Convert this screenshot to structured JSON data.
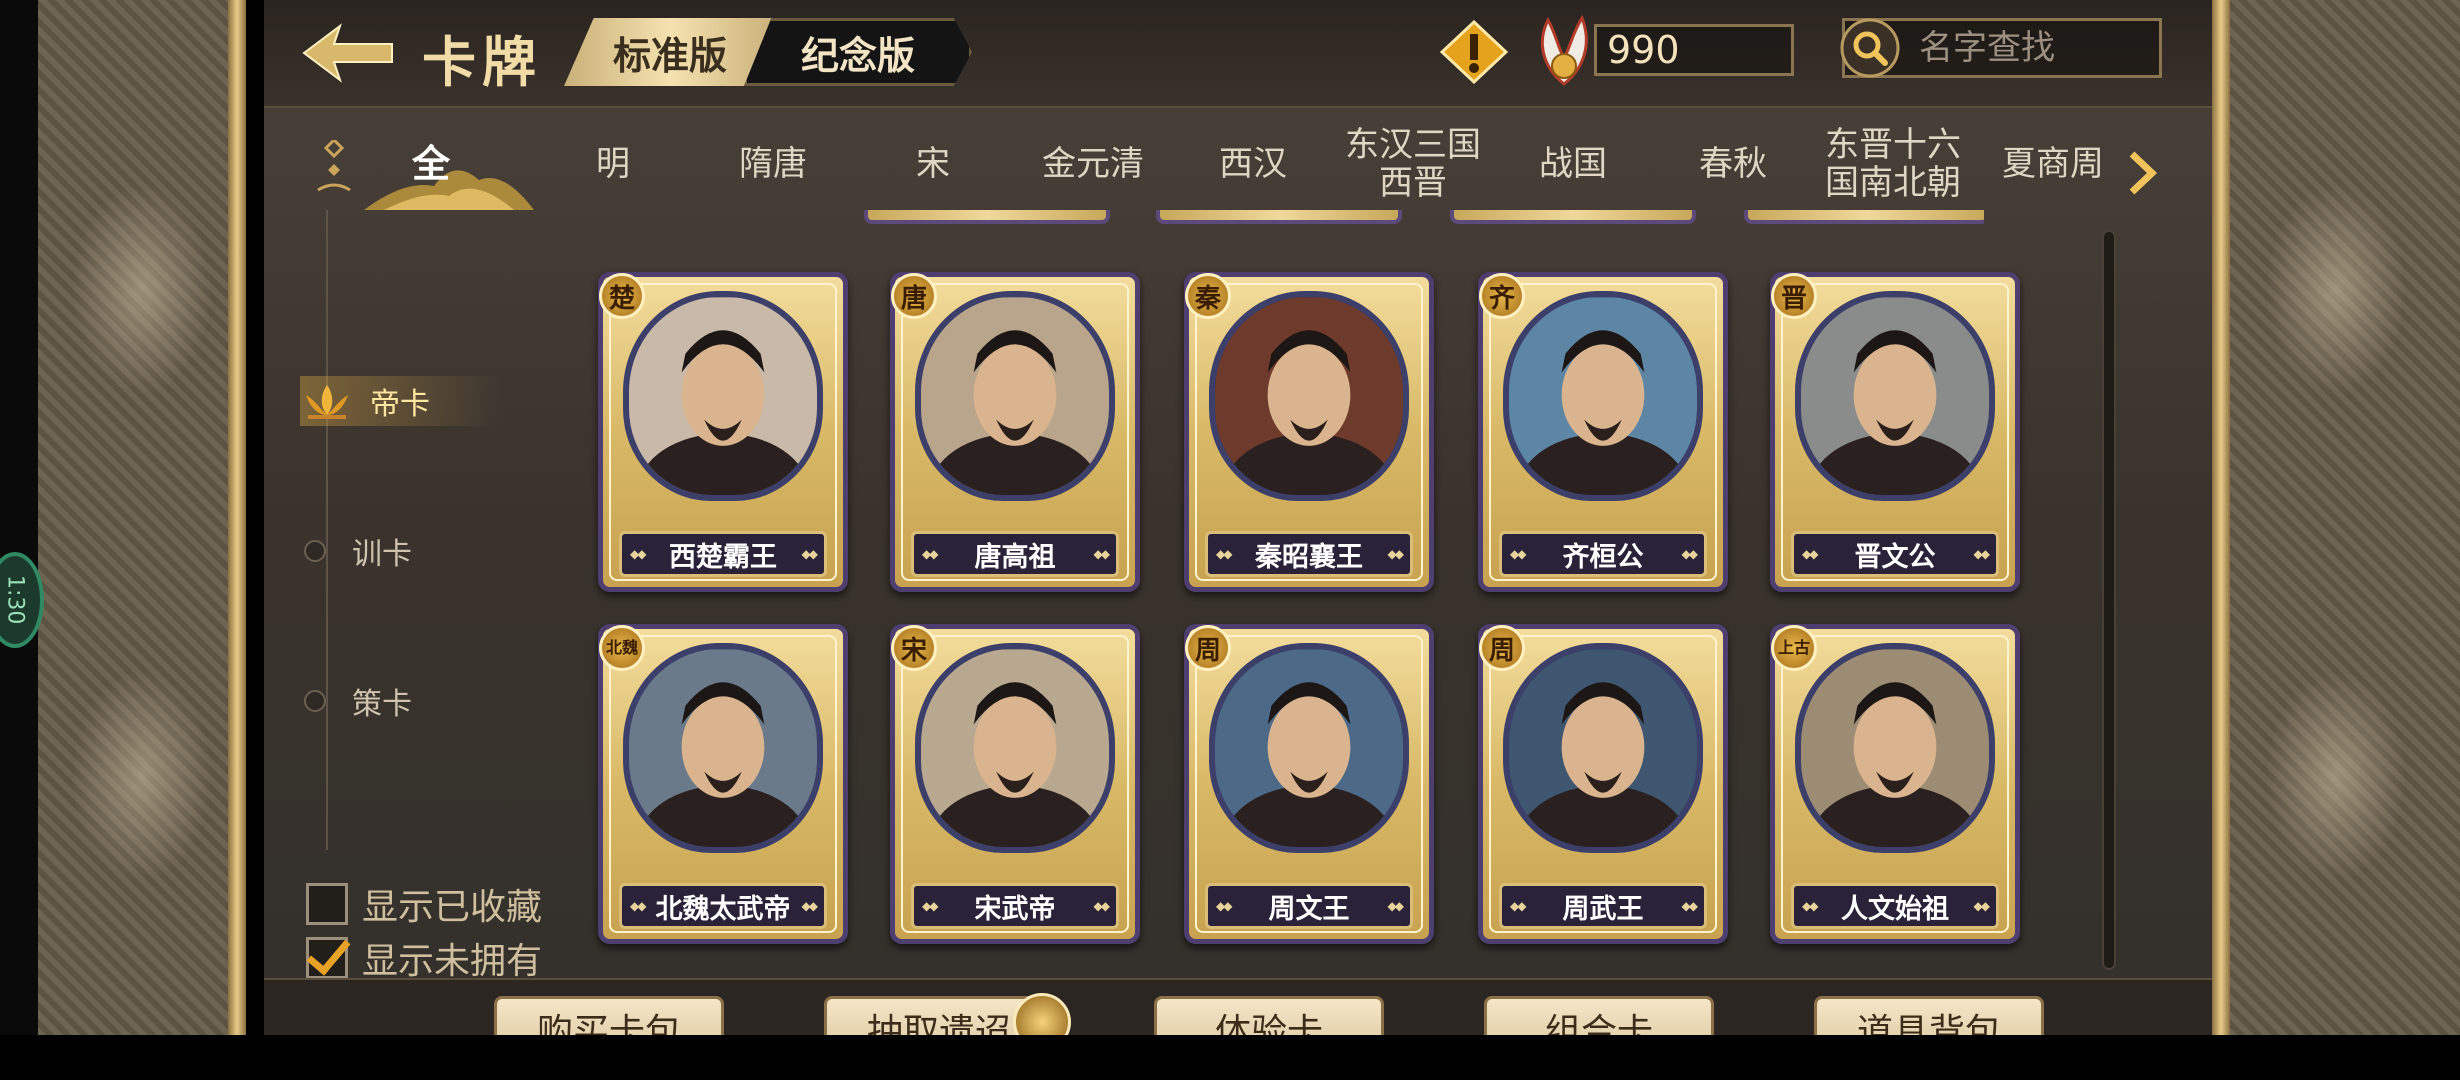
{
  "header": {
    "title": "卡牌",
    "version_tabs": [
      {
        "label": "标准版",
        "active": true
      },
      {
        "label": "纪念版",
        "active": false
      }
    ],
    "currency_value": "990",
    "search_placeholder": "名字查找"
  },
  "era_tabs": [
    {
      "label": "全",
      "active": true
    },
    {
      "label": "明"
    },
    {
      "label": "隋唐"
    },
    {
      "label": "宋"
    },
    {
      "label": "金元清"
    },
    {
      "label": "西汉"
    },
    {
      "label": "东汉三国\n西晋"
    },
    {
      "label": "战国"
    },
    {
      "label": "春秋"
    },
    {
      "label": "东晋十六\n国南北朝"
    },
    {
      "label": "夏商周"
    }
  ],
  "categories": [
    {
      "label": "帝卡",
      "active": true,
      "icon": "lotus-icon"
    },
    {
      "label": "训卡"
    },
    {
      "label": "策卡"
    }
  ],
  "cards": [
    {
      "dynasty": "楚",
      "name": "西楚霸王",
      "tone": "#c8b9a8"
    },
    {
      "dynasty": "唐",
      "name": "唐高祖",
      "tone": "#b9a58c"
    },
    {
      "dynasty": "秦",
      "name": "秦昭襄王",
      "tone": "#6d3a2c"
    },
    {
      "dynasty": "齐",
      "name": "齐桓公",
      "tone": "#5c86a4"
    },
    {
      "dynasty": "晋",
      "name": "晋文公",
      "tone": "#8a8c8c"
    },
    {
      "dynasty": "北魏",
      "name": "北魏太武帝",
      "tone": "#6a7a8a"
    },
    {
      "dynasty": "宋",
      "name": "宋武帝",
      "tone": "#b8a890"
    },
    {
      "dynasty": "周",
      "name": "周文王",
      "tone": "#4c6a88"
    },
    {
      "dynasty": "周",
      "name": "周武王",
      "tone": "#3e5670"
    },
    {
      "dynasty": "上古",
      "name": "人文始祖",
      "tone": "#9c8c74"
    }
  ],
  "filters": [
    {
      "label": "显示已收藏",
      "checked": false
    },
    {
      "label": "显示未拥有",
      "checked": true
    }
  ],
  "bottom_buttons": [
    {
      "label": "购买卡包"
    },
    {
      "label": "抽取遗迢"
    },
    {
      "label": "体验卡"
    },
    {
      "label": "组合卡"
    },
    {
      "label": "道具背包"
    }
  ],
  "side_badge": "1:30",
  "colors": {
    "gold": "#e8cc8a",
    "panel": "#3a332d",
    "card_border": "#4e3f70",
    "check": "#e8a226"
  }
}
